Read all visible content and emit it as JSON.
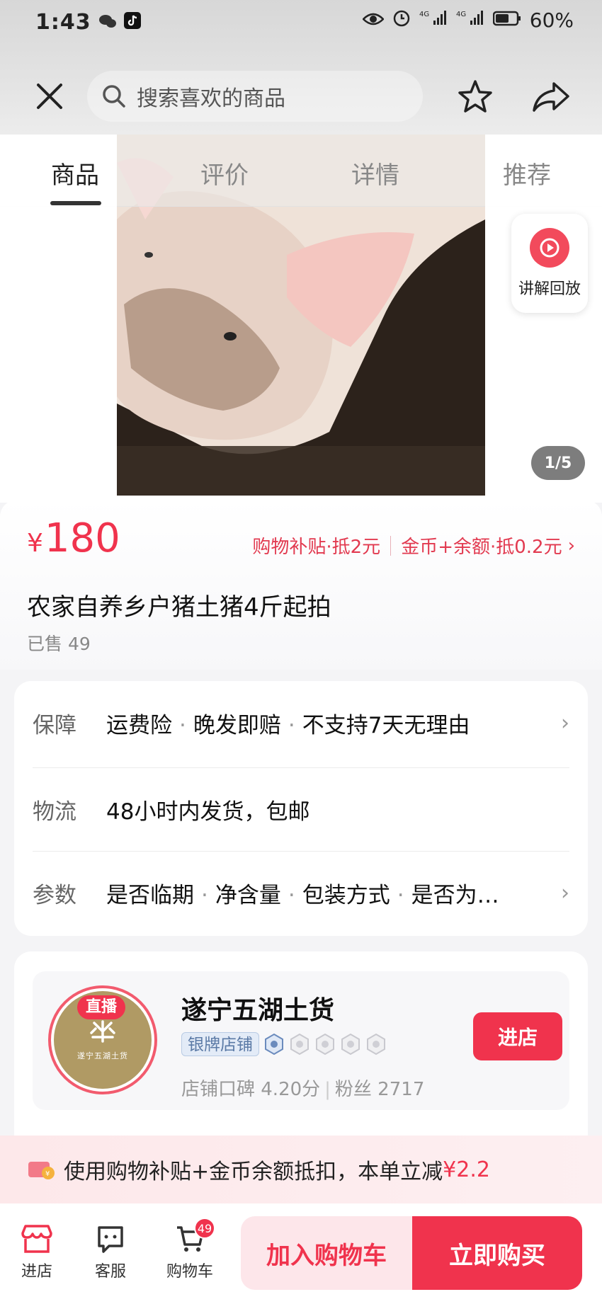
{
  "status_bar": {
    "time": "1:43",
    "battery_pct": "60%",
    "network_1": "4G",
    "network_2": "4G"
  },
  "header": {
    "search_placeholder": "搜索喜欢的商品"
  },
  "tabs": [
    {
      "label": "商品",
      "active": true
    },
    {
      "label": "评价",
      "active": false
    },
    {
      "label": "详情",
      "active": false
    },
    {
      "label": "推荐",
      "active": false
    }
  ],
  "gallery": {
    "replay_label": "讲解回放",
    "page_indicator": "1/5"
  },
  "product": {
    "price_symbol": "¥",
    "price": "180",
    "subsidy_1": "购物补贴·抵2元",
    "subsidy_2": "金币+余额·抵0.2元",
    "title": "农家自养乡户猪土猪4斤起拍",
    "sold": "已售 49"
  },
  "specs": {
    "guarantee_label": "保障",
    "guarantee_items": [
      "运费险",
      "晚发即赔",
      "不支持7天无理由"
    ],
    "logistics_label": "物流",
    "logistics_value": "48小时内发货，包邮",
    "params_label": "参数",
    "params_items": [
      "是否临期",
      "净含量",
      "包装方式",
      "是否为…"
    ]
  },
  "shop": {
    "live_badge": "直播",
    "avatar_text": "遂宁五湖土货",
    "name": "遂宁五湖土货",
    "tier": "银牌店铺",
    "rating": "店铺口碑 4.20分",
    "fans": "粉丝 2717",
    "enter_label": "进店"
  },
  "promo": {
    "text": "使用购物补贴+金币余额抵扣，本单立减",
    "amount": "¥2.2"
  },
  "bottom_bar": {
    "store_label": "进店",
    "service_label": "客服",
    "cart_label": "购物车",
    "cart_count": "49",
    "add_cart_label": "加入购物车",
    "buy_now_label": "立即购买"
  },
  "colors": {
    "accent": "#f0334d",
    "tier_blue": "#5b7aa6"
  }
}
